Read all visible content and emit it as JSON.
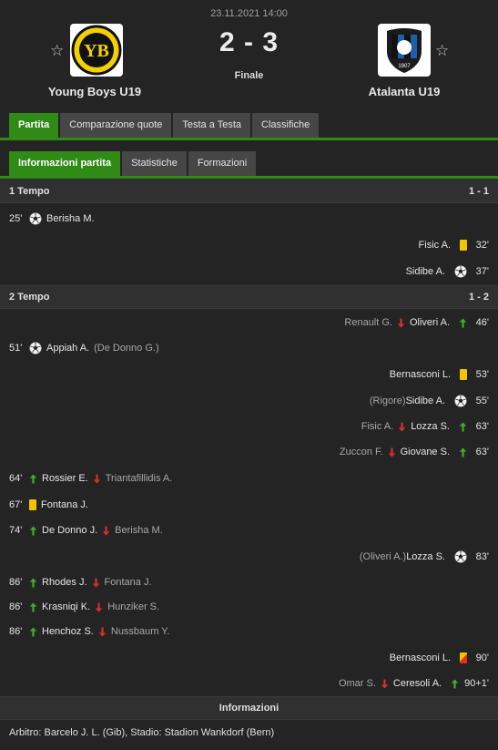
{
  "match": {
    "datetime": "23.11.2021 14:00",
    "score": "2 - 3",
    "status": "Finale",
    "home_team": "Young Boys U19",
    "away_team": "Atalanta U19"
  },
  "tabs_main": [
    "Partita",
    "Comparazione quote",
    "Testa a Testa",
    "Classifiche"
  ],
  "tabs_sub": [
    "Informazioni partita",
    "Statistiche",
    "Formazioni"
  ],
  "periods": [
    {
      "label": "1 Tempo",
      "score": "1 - 1",
      "events": [
        {
          "side": "home",
          "min": "25'",
          "icon": "ball",
          "player": "Berisha M.",
          "extra": ""
        },
        {
          "side": "away",
          "min": "32'",
          "icon": "yellow-card",
          "player": "Fisic A.",
          "extra": ""
        },
        {
          "side": "away",
          "min": "37'",
          "icon": "ball",
          "player": "Sidibe A.",
          "extra": ""
        }
      ]
    },
    {
      "label": "2 Tempo",
      "score": "1 - 2",
      "events": [
        {
          "side": "away",
          "min": "46'",
          "icon": "sub",
          "player": "Oliveri A.",
          "extra": "Renault G."
        },
        {
          "side": "home",
          "min": "51'",
          "icon": "ball",
          "player": "Appiah A.",
          "extra": "(De Donno G.)"
        },
        {
          "side": "away",
          "min": "53'",
          "icon": "yellow-card",
          "player": "Bernasconi L.",
          "extra": ""
        },
        {
          "side": "away",
          "min": "55'",
          "icon": "ball",
          "player": "Sidibe A.",
          "extra": "(Rigore)"
        },
        {
          "side": "away",
          "min": "63'",
          "icon": "sub",
          "player": "Lozza S.",
          "extra": "Fisic A."
        },
        {
          "side": "away",
          "min": "63'",
          "icon": "sub",
          "player": "Giovane S.",
          "extra": "Zuccon F."
        },
        {
          "side": "home",
          "min": "64'",
          "icon": "sub",
          "player": "Rossier E.",
          "extra": "Triantafillidis A."
        },
        {
          "side": "home",
          "min": "67'",
          "icon": "yellow-card",
          "player": "Fontana J.",
          "extra": ""
        },
        {
          "side": "home",
          "min": "74'",
          "icon": "sub",
          "player": "De Donno J.",
          "extra": "Berisha M."
        },
        {
          "side": "away",
          "min": "83'",
          "icon": "ball",
          "player": "Lozza S.",
          "extra": "(Oliveri A.)"
        },
        {
          "side": "home",
          "min": "86'",
          "icon": "sub",
          "player": "Rhodes J.",
          "extra": "Fontana J."
        },
        {
          "side": "home",
          "min": "86'",
          "icon": "sub",
          "player": "Krasniqi K.",
          "extra": "Hunziker S."
        },
        {
          "side": "home",
          "min": "86'",
          "icon": "sub",
          "player": "Henchoz S.",
          "extra": "Nussbaum Y."
        },
        {
          "side": "away",
          "min": "90'",
          "icon": "yellow-red-card",
          "player": "Bernasconi L.",
          "extra": ""
        },
        {
          "side": "away",
          "min": "90+1'",
          "icon": "sub",
          "player": "Ceresoli A.",
          "extra": "Omar S."
        }
      ]
    }
  ],
  "info": {
    "title": "Informazioni",
    "line": "Arbitro: Barcelo J. L. (Gib), Stadio: Stadion Wankdorf (Bern)"
  },
  "colors": {
    "accent": "#2f8a16",
    "yellow_card": "#f2c300",
    "red_card": "#e0301e",
    "sub_in": "#3fae2a",
    "sub_out": "#d8302a"
  }
}
